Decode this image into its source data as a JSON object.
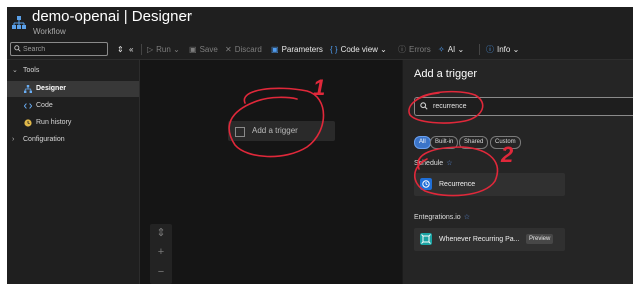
{
  "header": {
    "title": "demo-openai | Designer",
    "subtitle": "Workflow",
    "more": "···"
  },
  "toolbar": {
    "search_placeholder": "Search",
    "run": "Run",
    "save": "Save",
    "discard": "Discard",
    "parameters": "Parameters",
    "code_view": "Code view",
    "errors": "Errors",
    "ai": "AI",
    "info": "Info"
  },
  "sidebar": {
    "tools": "Tools",
    "designer": "Designer",
    "code": "Code",
    "run_history": "Run history",
    "configuration": "Configuration"
  },
  "canvas": {
    "add_trigger": "Add a trigger",
    "zoom_in": "+",
    "zoom_out": "−"
  },
  "panel": {
    "title": "Add a trigger",
    "search_value": "recurrence",
    "filters": [
      "All",
      "Built-in",
      "Shared",
      "Custom"
    ],
    "schedule_heading": "Schedule",
    "recurrence_label": "Recurrence",
    "integrations_heading": "Entegrations.io",
    "whenever_label": "Whenever Recurring Pa...",
    "preview_badge": "Preview"
  },
  "annotations": {
    "num1": "1",
    "num2": "2"
  },
  "colors": {
    "accent": "#3b74c8",
    "annotation": "#e0283a",
    "background": "#1b1b1b"
  }
}
